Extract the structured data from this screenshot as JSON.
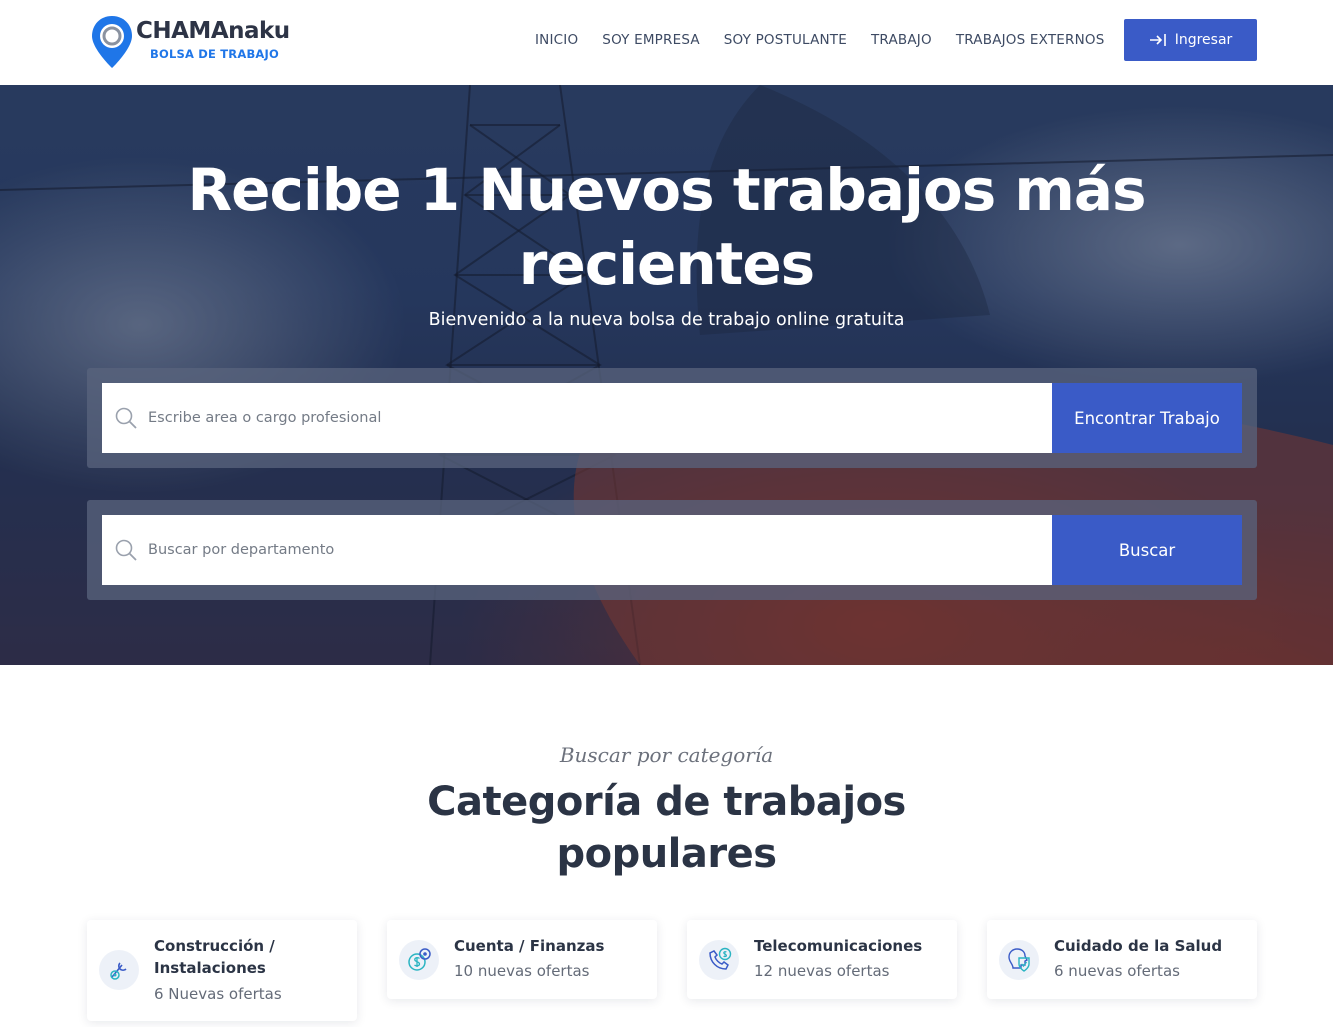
{
  "header": {
    "logo_title": "CHAMAnaku",
    "logo_subtitle": "BOLSA DE TRABAJO",
    "nav": [
      "INICIO",
      "SOY EMPRESA",
      "SOY POSTULANTE",
      "TRABAJO",
      "TRABAJOS EXTERNOS"
    ],
    "login_label": "Ingresar",
    "login_icon": "login-arrow-icon"
  },
  "hero": {
    "title_line1": "Recibe 1 Nuevos trabajos más",
    "title_line2": "recientes",
    "subtitle": "Bienvenido a la nueva bolsa de trabajo online gratuita",
    "search_job": {
      "placeholder": "Escribe area o cargo profesional",
      "button": "Encontrar Trabajo",
      "icon": "search-icon"
    },
    "search_department": {
      "placeholder": "Buscar por departamento",
      "button": "Buscar",
      "icon": "search-icon"
    }
  },
  "categories": {
    "eyebrow": "Buscar por categoría",
    "title_line1": "Categoría de trabajos",
    "title_line2": "populares",
    "items": [
      {
        "title_line1": "Construcción /",
        "title_line2": "Instalaciones",
        "count": "6 Nuevas ofertas",
        "icon": "construction-icon"
      },
      {
        "title": "Cuenta / Finanzas",
        "count": "10 nuevas ofertas",
        "icon": "finance-icon"
      },
      {
        "title": "Telecomunicaciones",
        "count": "12 nuevas ofertas",
        "icon": "telecom-icon"
      },
      {
        "title": "Cuidado de la Salud",
        "count": "6 nuevas ofertas",
        "icon": "healthcare-icon"
      }
    ]
  },
  "colors": {
    "accent": "#3a5bc7",
    "heading": "#2b3445",
    "logo_blue": "#1f76e8"
  }
}
